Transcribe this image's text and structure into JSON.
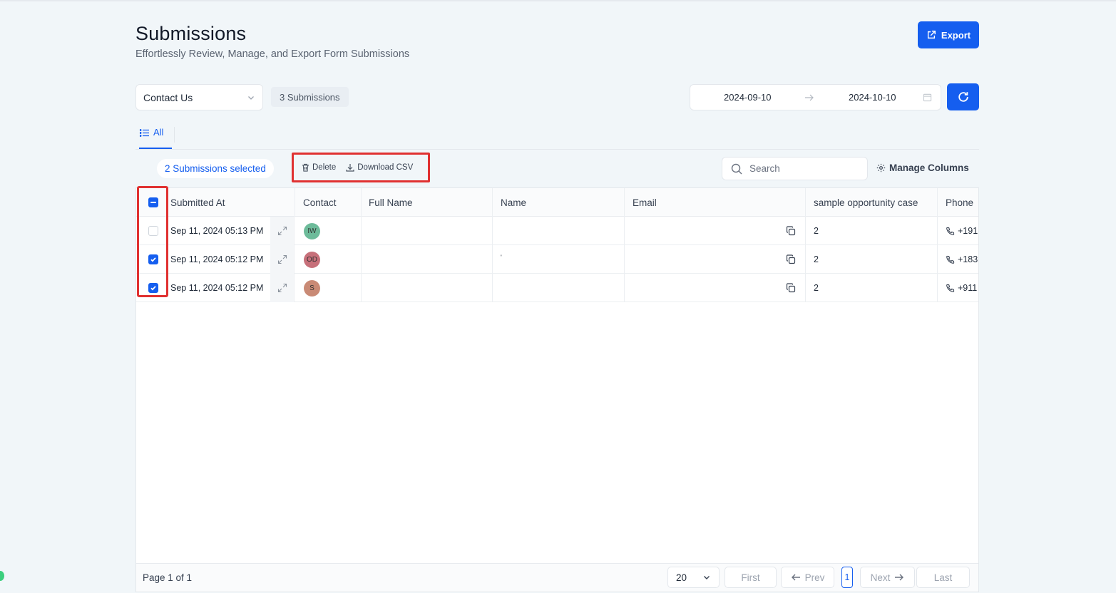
{
  "header": {
    "title": "Submissions",
    "subtitle": "Effortlessly Review, Manage, and Export Form Submissions",
    "export_label": "Export"
  },
  "filters": {
    "form_selected": "Contact Us",
    "submission_count": "3 Submissions",
    "date_start": "2024-09-10",
    "date_end": "2024-10-10"
  },
  "tabs": [
    {
      "label": "All",
      "active": true
    }
  ],
  "toolbar": {
    "selected_text": "2 Submissions selected",
    "delete_label": "Delete",
    "download_label": "Download CSV",
    "search_placeholder": "Search",
    "manage_columns_label": "Manage Columns"
  },
  "table": {
    "columns": [
      "Submitted At",
      "Contact",
      "Full Name",
      "Name",
      "Email",
      "sample opportunity case",
      "Phone"
    ],
    "rows": [
      {
        "checked": false,
        "submitted_at": "Sep 11, 2024  05:13 PM",
        "contact_initials": "IW",
        "avatar_color": "#6dbb9a",
        "full_name": "",
        "name": "",
        "email": "",
        "opportunity": "2",
        "phone": "+191"
      },
      {
        "checked": true,
        "submitted_at": "Sep 11, 2024  05:12 PM",
        "contact_initials": "OD",
        "avatar_color": "#c7707a",
        "full_name": "",
        "name": "'",
        "email": "",
        "opportunity": "2",
        "phone": "+183"
      },
      {
        "checked": true,
        "submitted_at": "Sep 11, 2024  05:12 PM",
        "contact_initials": "S",
        "avatar_color": "#c98a75",
        "full_name": "",
        "name": "",
        "email": "",
        "opportunity": "2",
        "phone": "+911"
      }
    ]
  },
  "pagination": {
    "page_info": "Page 1 of 1",
    "page_size": "20",
    "first": "First",
    "prev": "Prev",
    "current": "1",
    "next": "Next",
    "last": "Last"
  },
  "colors": {
    "accent": "#155eef",
    "highlight": "#e03131",
    "background": "#f1f6f9"
  }
}
